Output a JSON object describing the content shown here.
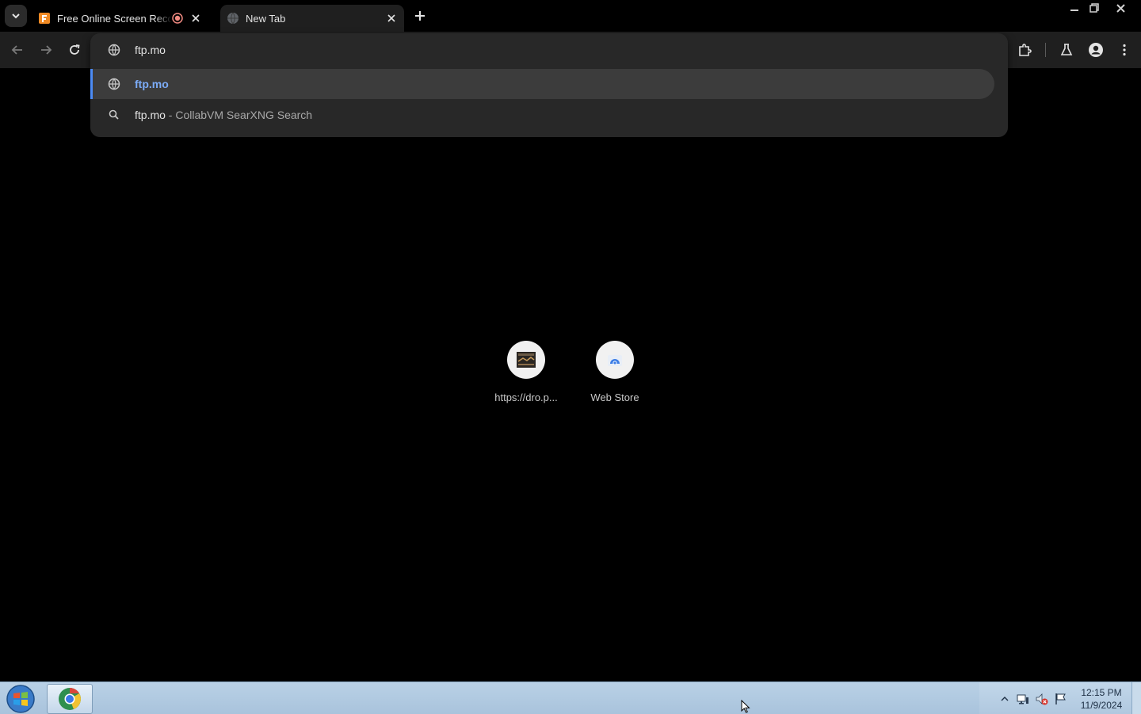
{
  "browser": {
    "tabs": [
      {
        "title": "Free Online Screen Recorder",
        "recording": true,
        "active": false
      },
      {
        "title": "New Tab",
        "active": true
      }
    ],
    "accent_color": "#4c8bf5"
  },
  "omnibox": {
    "value": "ftp.mo",
    "suggestions": [
      {
        "icon": "globe-icon",
        "text": "ftp.mo",
        "selected": true
      },
      {
        "icon": "search-icon",
        "primary": "ftp.mo",
        "secondary": " - CollabVM SearXNG Search",
        "selected": false
      }
    ]
  },
  "shortcuts": [
    {
      "label": "https://dro.p...",
      "icon": "site-thumbnail-icon"
    },
    {
      "label": "Web Store",
      "icon": "web-store-icon"
    }
  ],
  "taskbar": {
    "clock_time": "12:15 PM",
    "clock_date": "11/9/2024"
  }
}
